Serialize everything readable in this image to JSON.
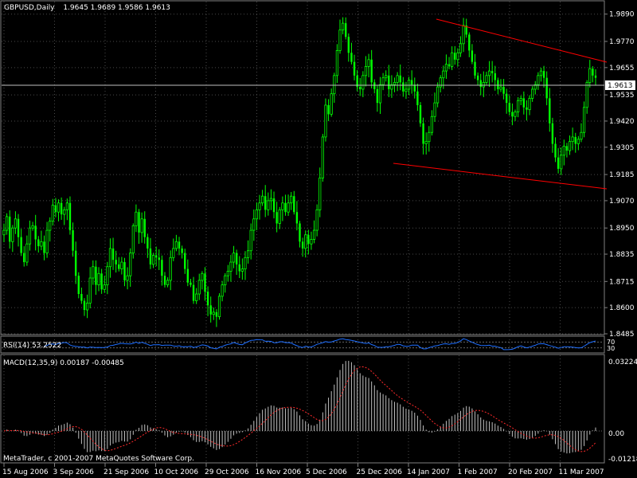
{
  "colors": {
    "background": "#000000",
    "grid": "#4a4a4a",
    "candle": "#00ff00",
    "trendline": "#ff0000",
    "rsi_line": "#1e6eff",
    "macd_hist": "#c0c0c0",
    "macd_signal": "#ff2a2a",
    "text": "#ffffff",
    "price_label_bg": "#ffffff",
    "price_label_text": "#000000"
  },
  "chart_data": [
    {
      "type": "candlestick",
      "title": "GBPUSD,Daily",
      "ohlc_header": "1.9645 1.9689 1.9586 1.9613",
      "last_price_label": "1.9613",
      "y_ticks": [
        "1.9890",
        "1.9770",
        "1.9655",
        "1.9535",
        "1.9420",
        "1.9305",
        "1.9185",
        "1.9070",
        "1.8950",
        "1.8835",
        "1.8715",
        "1.8600",
        "1.8485"
      ],
      "ylim": [
        1.8485,
        1.9945
      ],
      "x_ticks": [
        "15 Aug 2006",
        "3 Sep 2006",
        "21 Sep 2006",
        "10 Oct 2006",
        "29 Oct 2006",
        "16 Nov 2006",
        "5 Dec 2006",
        "25 Dec 2006",
        "14 Jan 2007",
        "1 Feb 2007",
        "20 Feb 2007",
        "11 Mar 2007"
      ],
      "closes": [
        1.894,
        1.9,
        1.889,
        1.895,
        1.899,
        1.891,
        1.884,
        1.88,
        1.888,
        1.895,
        1.896,
        1.89,
        1.887,
        1.889,
        1.884,
        1.894,
        1.898,
        1.905,
        1.902,
        1.906,
        1.901,
        1.903,
        1.906,
        1.894,
        1.885,
        1.874,
        1.866,
        1.863,
        1.859,
        1.862,
        1.873,
        1.878,
        1.87,
        1.875,
        1.868,
        1.87,
        1.878,
        1.886,
        1.881,
        1.879,
        1.877,
        1.88,
        1.872,
        1.874,
        1.884,
        1.896,
        1.902,
        1.893,
        1.899,
        1.891,
        1.886,
        1.879,
        1.883,
        1.882,
        1.881,
        1.874,
        1.87,
        1.872,
        1.882,
        1.886,
        1.889,
        1.886,
        1.884,
        1.877,
        1.871,
        1.87,
        1.863,
        1.866,
        1.872,
        1.875,
        1.867,
        1.861,
        1.857,
        1.858,
        1.856,
        1.865,
        1.87,
        1.874,
        1.876,
        1.88,
        1.884,
        1.879,
        1.876,
        1.877,
        1.882,
        1.885,
        1.894,
        1.899,
        1.903,
        1.906,
        1.909,
        1.903,
        1.907,
        1.908,
        1.902,
        1.897,
        1.903,
        1.906,
        1.902,
        1.906,
        1.909,
        1.902,
        1.897,
        1.889,
        1.886,
        1.892,
        1.888,
        1.89,
        1.894,
        1.903,
        1.917,
        1.935,
        1.949,
        1.945,
        1.954,
        1.962,
        1.973,
        1.982,
        1.985,
        1.979,
        1.972,
        1.968,
        1.962,
        1.957,
        1.956,
        1.962,
        1.966,
        1.969,
        1.959,
        1.956,
        1.95,
        1.958,
        1.961,
        1.962,
        1.956,
        1.958,
        1.959,
        1.962,
        1.959,
        1.955,
        1.956,
        1.96,
        1.958,
        1.955,
        1.949,
        1.941,
        1.932,
        1.933,
        1.937,
        1.944,
        1.95,
        1.957,
        1.961,
        1.964,
        1.967,
        1.966,
        1.972,
        1.969,
        1.972,
        1.976,
        1.984,
        1.98,
        1.973,
        1.968,
        1.962,
        1.96,
        1.957,
        1.959,
        1.962,
        1.964,
        1.963,
        1.96,
        1.956,
        1.957,
        1.954,
        1.95,
        1.946,
        1.944,
        1.946,
        1.951,
        1.952,
        1.948,
        1.947,
        1.952,
        1.956,
        1.958,
        1.962,
        1.964,
        1.961,
        1.952,
        1.941,
        1.932,
        1.926,
        1.921,
        1.927,
        1.931,
        1.929,
        1.933,
        1.935,
        1.932,
        1.934,
        1.937,
        1.948,
        1.959,
        1.965,
        1.962,
        1.961
      ]
    },
    {
      "type": "line",
      "title": "RSI(14) 53.2522",
      "y_ticks": [
        "70",
        "30"
      ]
    },
    {
      "type": "bar",
      "title": "MACD(12,35,9) 0.00187 -0.00485",
      "y_ticks": [
        "0.03224",
        "0.00",
        "-0.01218"
      ],
      "ylim": [
        -0.0138,
        0.0336
      ]
    }
  ],
  "footer": "MetaTrader, c 2001-2007 MetaQuotes Software Corp."
}
